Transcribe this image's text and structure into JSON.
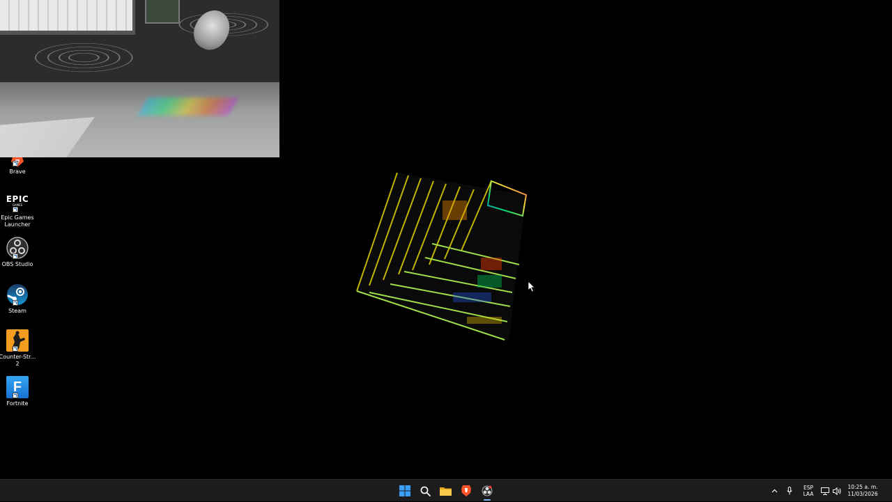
{
  "desktop": {
    "icons": [
      {
        "label": "Brave"
      },
      {
        "label": "Epic Games Launcher",
        "logo_text": "EPIC",
        "logo_sub": "GAMES"
      },
      {
        "label": "OBS Studio"
      },
      {
        "label": "Steam"
      },
      {
        "label": "Counter-Str... 2"
      },
      {
        "label": "Fortnite",
        "logo_text": "F"
      }
    ]
  },
  "taskbar": {
    "apps": [
      "windows-start",
      "search",
      "file-explorer",
      "brave",
      "obs-studio"
    ],
    "tray": {
      "language_line1": "ESP",
      "language_line2": "LAA",
      "time": "10:25 a. m.",
      "date": "11/03/2026"
    }
  },
  "colors": {
    "taskbar_bg": "#1c1c1c",
    "desktop_bg": "#000000",
    "accent": "#7fb2f0"
  }
}
